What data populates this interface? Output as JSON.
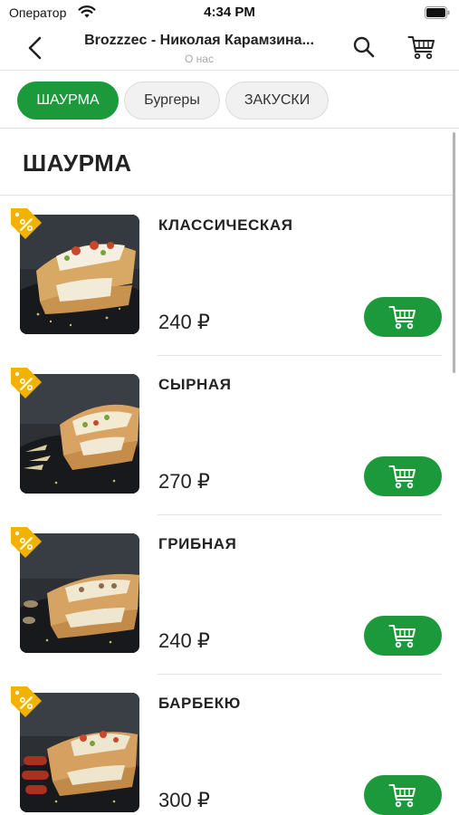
{
  "status_bar": {
    "carrier": "Оператор",
    "time": "4:34 PM"
  },
  "header": {
    "title": "Brozzzec - Николая Карамзина...",
    "subtitle": "О нас",
    "icons": [
      "chevron-left-icon",
      "search-icon",
      "cart-icon"
    ]
  },
  "categories": [
    {
      "label": "ШАУРМА",
      "active": true
    },
    {
      "label": "Бургеры",
      "active": false
    },
    {
      "label": "ЗАКУСКИ",
      "active": false
    }
  ],
  "section": {
    "title": "ШАУРМА"
  },
  "products": [
    {
      "name": "КЛАССИЧЕСКАЯ",
      "price": "240 ₽"
    },
    {
      "name": "СЫРНАЯ",
      "price": "270 ₽"
    },
    {
      "name": "ГРИБНАЯ",
      "price": "240 ₽"
    },
    {
      "name": "БАРБЕКЮ",
      "price": "300 ₽"
    }
  ],
  "colors": {
    "accent": "#1c9a3b",
    "badge": "#f2b200",
    "image_background": "#2b2e33"
  }
}
